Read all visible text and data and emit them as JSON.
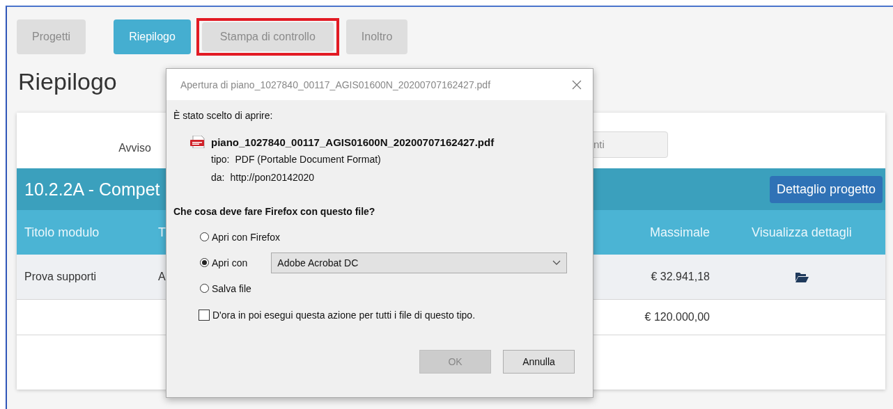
{
  "tabs": [
    {
      "label": "Progetti",
      "selected": false,
      "highlighted": false
    },
    {
      "label": "Riepilogo",
      "selected": true,
      "highlighted": false
    },
    {
      "label": "Stampa di controllo",
      "selected": false,
      "highlighted": true
    },
    {
      "label": "Inoltro",
      "selected": false,
      "highlighted": false
    }
  ],
  "heading": "Riepilogo",
  "filter": {
    "label": "Avviso",
    "search_value": "nti"
  },
  "project": {
    "title": "10.2.2A - Compet",
    "button": "Dettaglio progetto"
  },
  "table": {
    "columns": [
      "Titolo modulo",
      "T",
      "Massimale",
      "Visualizza dettagli"
    ],
    "rows": [
      {
        "title": "Prova supporti",
        "column_2": "A",
        "massimale": "€ 32.941,18",
        "details": true
      },
      {
        "massimale": "€ 120.000,00",
        "details": false
      }
    ]
  },
  "dialog": {
    "title": "Apertura di piano_1027840_00117_AGIS01600N_20200707162427.pdf",
    "intro": "È stato scelto di aprire:",
    "file_name": "piano_1027840_00117_AGIS01600N_20200707162427.pdf",
    "type_label": "tipo:",
    "type_value": "PDF (Portable Document Format)",
    "from_label": "da:",
    "from_value": "http://pon20142020",
    "question": "Che cosa deve fare Firefox con questo file?",
    "options": [
      {
        "kind": "radio",
        "label": "Apri con Firefox",
        "selected": false
      },
      {
        "kind": "radio_select",
        "label": "Apri con",
        "selected": true,
        "value": "Adobe Acrobat DC"
      },
      {
        "kind": "radio",
        "label": "Salva file",
        "selected": false
      }
    ],
    "remember": {
      "label": "D'ora in poi esegui questa azione per tutti i file di questo tipo.",
      "checked": false
    },
    "buttons": [
      {
        "label": "OK",
        "disabled": true
      },
      {
        "label": "Annulla",
        "disabled": false
      }
    ]
  }
}
